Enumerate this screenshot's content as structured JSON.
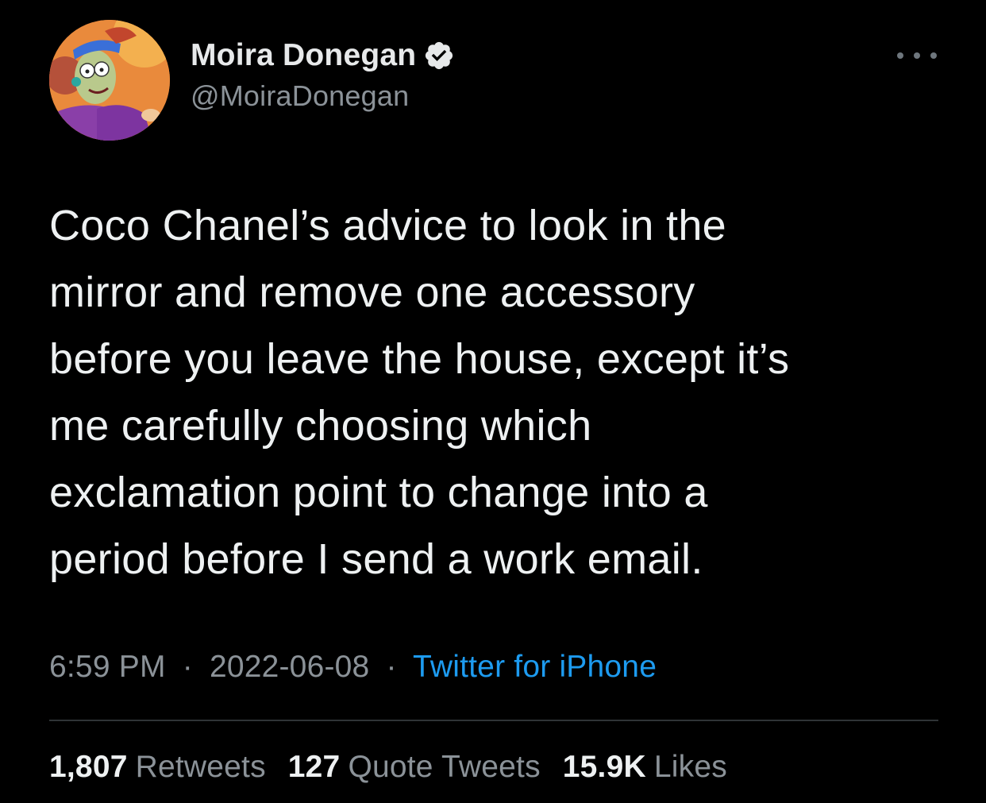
{
  "author": {
    "display_name": "Moira Donegan",
    "handle": "@MoiraDonegan",
    "verified": true,
    "avatar_icon": "cartoon-avatar"
  },
  "menu": {
    "icon": "more-options-icon"
  },
  "tweet": {
    "lines": [
      "Coco Chanel’s advice to look in the",
      "mirror and remove one accessory",
      "before you leave the house, except it’s",
      "me carefully choosing which",
      "exclamation point to change into a",
      "period before I send a work email."
    ]
  },
  "meta": {
    "time": "6:59 PM",
    "separator": "·",
    "date": "2022-06-08",
    "source": "Twitter for iPhone"
  },
  "stats": {
    "retweets": {
      "count": "1,807",
      "label": "Retweets"
    },
    "quote_tweets": {
      "count": "127",
      "label": "Quote Tweets"
    },
    "likes": {
      "count": "15.9K",
      "label": "Likes"
    }
  },
  "colors": {
    "background": "#000000",
    "text": "#e7e9ea",
    "secondary_text": "#8b9298",
    "link": "#1d9bf0",
    "divider": "#2f3336"
  }
}
